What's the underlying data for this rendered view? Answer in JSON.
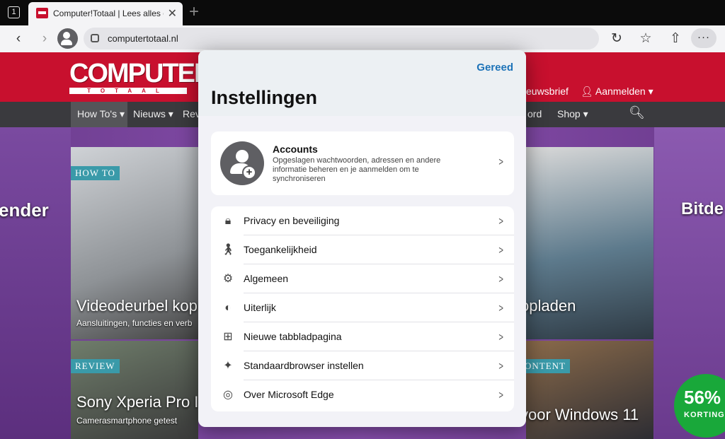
{
  "browser": {
    "tab_count": "1",
    "tab_title": "Computer!Totaal | Lees alles over",
    "new_tab_symbol": "+",
    "url": "computertotaal.nl",
    "more_symbol": "···"
  },
  "site": {
    "logo_top": "COMPUTER!",
    "logo_bottom": "TOTAAL",
    "newsletter": "euwsbrief",
    "signin": "Aanmelden",
    "nav": [
      "How To's",
      "Nieuws",
      "Rev",
      "ord",
      "Shop"
    ],
    "cards": {
      "howto_ribbon": "HOW TO",
      "howto_title": "Videodeurbel kop",
      "howto_sub": "Aansluitingen, functies en verb",
      "charge_title": "opladen",
      "review_ribbon": "REVIEW",
      "review_title": "Sony Xperia Pro I",
      "review_sub": "Camerasmartphone getest",
      "content_ribbon": "ONTENT",
      "windows_title": "voor Windows 11"
    },
    "ad_left": "ender",
    "ad_right": "Bitde",
    "badge_pct": "56%",
    "badge_label": "KORTING"
  },
  "settings": {
    "done": "Gereed",
    "title": "Instellingen",
    "account_title": "Accounts",
    "account_desc": "Opgeslagen wachtwoorden, adressen en andere informatie beheren en je aanmelden om te synchroniseren",
    "items": [
      {
        "label": "Privacy en beveiliging",
        "icon": "lock-icon"
      },
      {
        "label": "Toegankelijkheid",
        "icon": "accessibility-icon"
      },
      {
        "label": "Algemeen",
        "icon": "gear-icon"
      },
      {
        "label": "Uiterlijk",
        "icon": "palette-icon"
      },
      {
        "label": "Nieuwe tabbladpagina",
        "icon": "new-tab-icon"
      },
      {
        "label": "Standaardbrowser instellen",
        "icon": "default-browser-icon"
      },
      {
        "label": "Over Microsoft Edge",
        "icon": "edge-icon"
      }
    ]
  }
}
